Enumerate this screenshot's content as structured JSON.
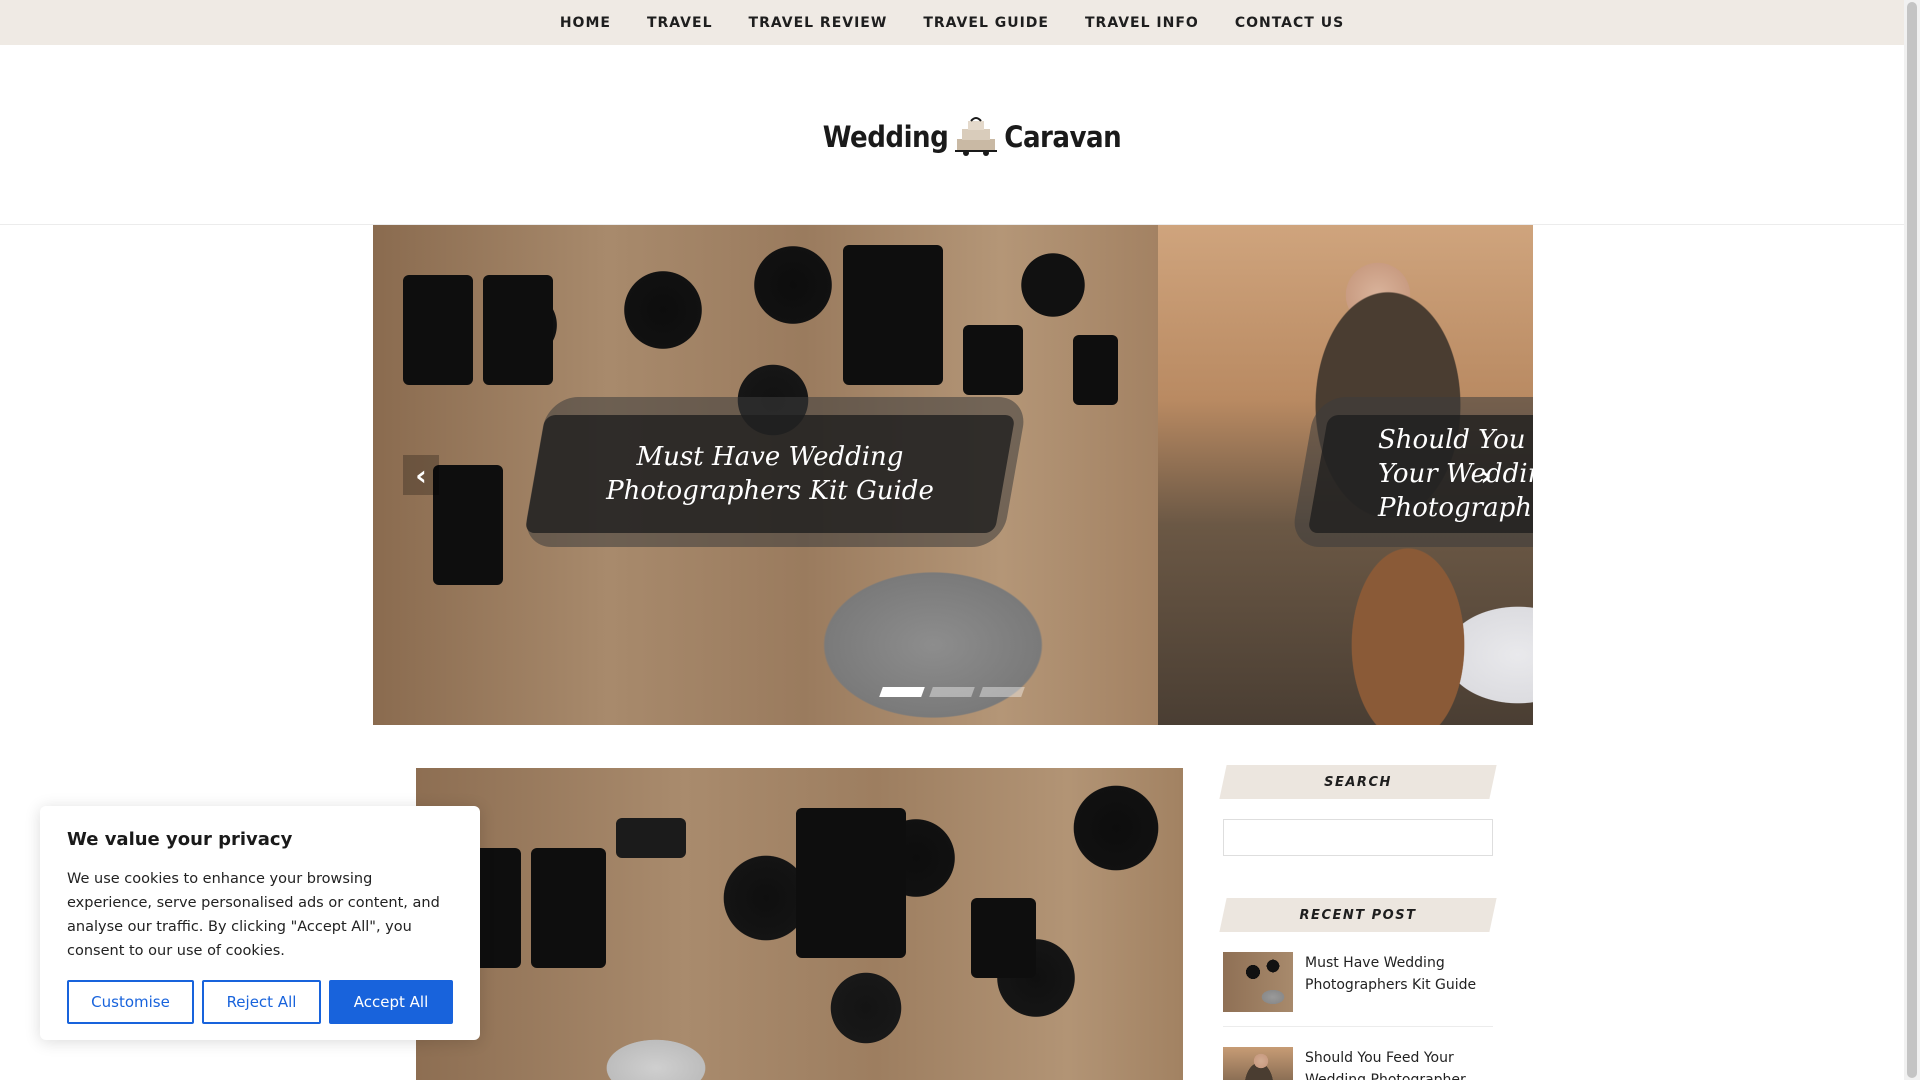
{
  "nav": {
    "items": [
      "HOME",
      "TRAVEL",
      "TRAVEL REVIEW",
      "TRAVEL GUIDE",
      "TRAVEL INFO",
      "CONTACT US"
    ]
  },
  "logo": {
    "left": "Wedding",
    "right": "Caravan",
    "icon": "caravan-cake-icon"
  },
  "slider": {
    "slides": [
      {
        "title": "Must Have Wedding Photographers Kit Guide"
      },
      {
        "title": "Should You Feed Your Wedding Photographer"
      }
    ],
    "prev_icon": "chevron-left-icon",
    "next_icon": "chevron-right-icon",
    "prev_glyph": "‹",
    "next_glyph": "›",
    "dot_count": 3,
    "active_dot": 1
  },
  "sidebar": {
    "search_title": "SEARCH",
    "search_placeholder": "",
    "recent_title": "RECENT POST",
    "recent_posts": [
      {
        "title": "Must Have Wedding Photographers Kit Guide"
      },
      {
        "title": "Should You Feed Your Wedding Photographer"
      }
    ]
  },
  "cookie": {
    "title": "We value your privacy",
    "body": "We use cookies to enhance your browsing experience, serve personalised ads or content, and analyse our traffic. By clicking \"Accept All\", you consent to our use of cookies.",
    "customise": "Customise",
    "reject": "Reject All",
    "accept": "Accept All",
    "accent_color": "#1863dc"
  }
}
